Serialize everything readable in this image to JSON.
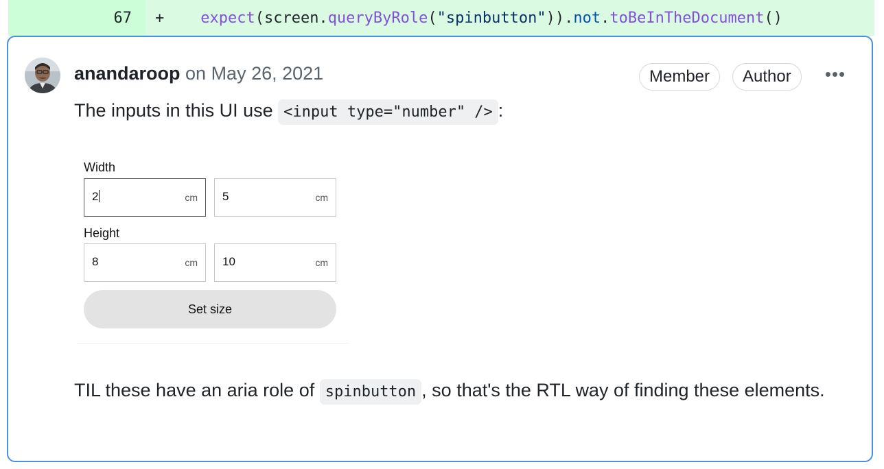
{
  "diff": {
    "line_number": "67",
    "marker": "+",
    "code_tokens": [
      {
        "text": "    ",
        "kind": "plain"
      },
      {
        "text": "expect",
        "kind": "fn"
      },
      {
        "text": "(screen.",
        "kind": "plain"
      },
      {
        "text": "queryByRole",
        "kind": "fn"
      },
      {
        "text": "(",
        "kind": "plain"
      },
      {
        "text": "\"spinbutton\"",
        "kind": "str"
      },
      {
        "text": ")).",
        "kind": "plain"
      },
      {
        "text": "not",
        "kind": "key"
      },
      {
        "text": ".",
        "kind": "plain"
      },
      {
        "text": "toBeInTheDocument",
        "kind": "fn"
      },
      {
        "text": "()",
        "kind": "plain"
      }
    ]
  },
  "comment": {
    "author": "anandaroop",
    "date_text": "on May 26, 2021",
    "badges": {
      "member": "Member",
      "author": "Author"
    },
    "more_label": "•••",
    "p1_before": "The inputs in this UI use ",
    "p1_code": "<input type=\"number\" />",
    "p1_after": ":",
    "p2_before": "TIL these have an aria role of ",
    "p2_code": "spinbutton",
    "p2_after": ", so that's the RTL way of finding these elements."
  },
  "embed": {
    "width_label": "Width",
    "height_label": "Height",
    "fields": [
      {
        "value": "2",
        "unit": "cm"
      },
      {
        "value": "5",
        "unit": "cm"
      },
      {
        "value": "8",
        "unit": "cm"
      },
      {
        "value": "10",
        "unit": "cm"
      }
    ],
    "button_label": "Set size"
  },
  "colors": {
    "accent_border": "#4a8fe0",
    "diff_added_bg": "#dafbe1",
    "diff_number_bg": "#ccffd8"
  }
}
